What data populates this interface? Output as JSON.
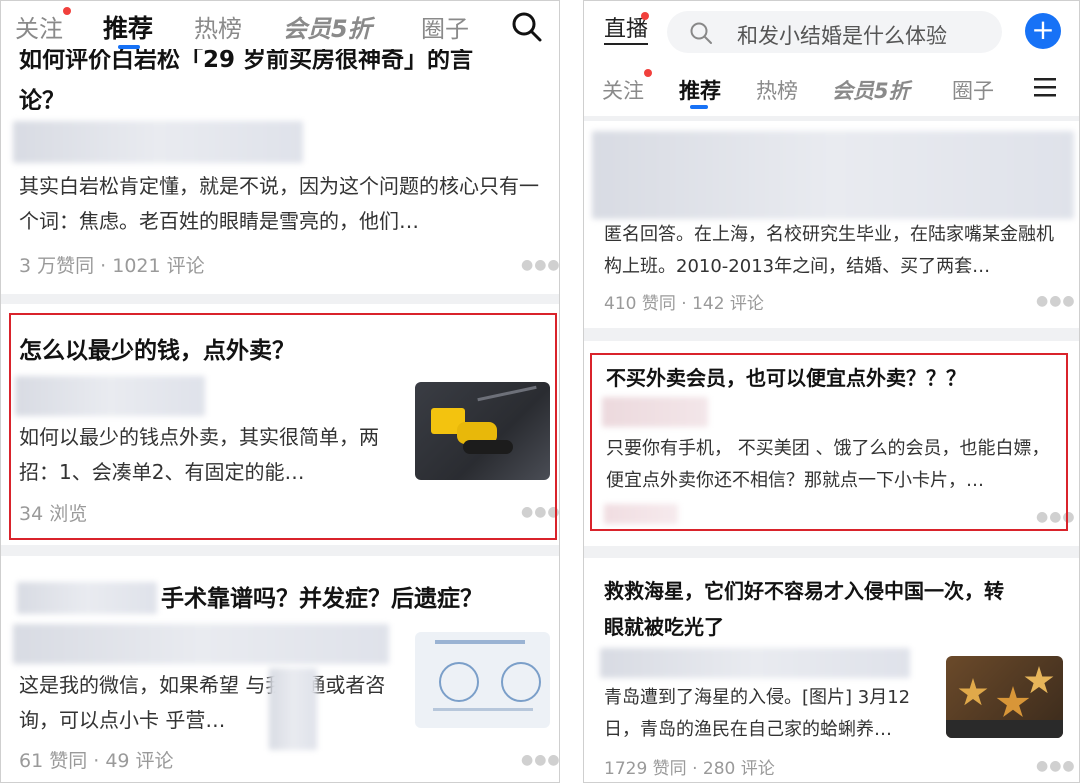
{
  "left": {
    "tabs": [
      "关注",
      "推荐",
      "热榜",
      "会员5折",
      "圈子"
    ],
    "card1": {
      "title_line1": "如何评价白岩松「29 岁前买房很神奇」的言",
      "title_line2": "论？",
      "excerpt": "其实白岩松肯定懂，就是不说，因为这个问题的核心只有一个词：焦虑。老百姓的眼睛是雪亮的，他们…",
      "meta": "3 万赞同 · 1021 评论"
    },
    "card2": {
      "title": "怎么以最少的钱，点外卖？",
      "excerpt": "如何以最少的钱点外卖，其实很简单，两招：1、会凑单2、有固定的能…",
      "meta": "34 浏览"
    },
    "card3": {
      "title": "手术靠谱吗？并发症？后遗症？",
      "excerpt": "这是我的微信，如果希望 与我沟通或者咨询，可以点小卡 乎营…",
      "meta": "61 赞同 · 49 评论"
    }
  },
  "right": {
    "live_label": "直播",
    "search_placeholder": "和发小结婚是什么体验",
    "tabs": [
      "关注",
      "推荐",
      "热榜",
      "会员5折",
      "圈子"
    ],
    "card1": {
      "excerpt": "匿名回答。在上海，名校研究生毕业，在陆家嘴某金融机构上班。2010-2013年之间，结婚、买了两套…",
      "meta": "410 赞同 · 142 评论"
    },
    "card2": {
      "title": "不买外卖会员，也可以便宜点外卖？？？",
      "excerpt": "只要你有手机， 不买美团 、饿了么的会员，也能白嫖，便宜点外卖你还不相信？那就点一下小卡片，…"
    },
    "card3": {
      "title_line1": "救救海星，它们好不容易才入侵中国一次，转",
      "title_line2": "眼就被吃光了",
      "excerpt": "青岛遭到了海星的入侵。[图片] 3月12日，青岛的渔民在自己家的蛤蜊养…",
      "meta": "1729 赞同 · 280 评论"
    }
  },
  "colors": {
    "accent": "#1772f6",
    "highlight": "#d9232b",
    "badge": "#f1403c"
  },
  "icons": [
    "search-icon",
    "plus-icon",
    "menu-icon",
    "more-icon"
  ]
}
